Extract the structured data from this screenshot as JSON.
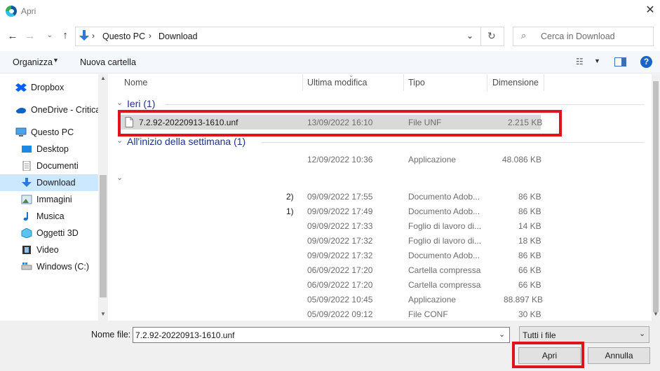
{
  "window": {
    "title": "Apri"
  },
  "address": {
    "crumbs": [
      "Questo PC",
      "Download"
    ],
    "search_placeholder": "Cerca in Download"
  },
  "toolbar": {
    "organize_label": "Organizza",
    "new_folder_label": "Nuova cartella"
  },
  "sidebar": {
    "items": [
      {
        "label": "Dropbox",
        "icon": "dropbox-icon"
      },
      {
        "label": "OneDrive - Critica",
        "icon": "onedrive-icon"
      },
      {
        "label": "Questo PC",
        "icon": "pc-icon"
      },
      {
        "label": "Desktop",
        "icon": "desktop-icon"
      },
      {
        "label": "Documenti",
        "icon": "documents-icon"
      },
      {
        "label": "Download",
        "icon": "download-icon",
        "selected": true
      },
      {
        "label": "Immagini",
        "icon": "pictures-icon"
      },
      {
        "label": "Musica",
        "icon": "music-icon"
      },
      {
        "label": "Oggetti 3D",
        "icon": "objects3d-icon"
      },
      {
        "label": "Video",
        "icon": "video-icon"
      },
      {
        "label": "Windows (C:)",
        "icon": "drive-icon"
      }
    ]
  },
  "columns": {
    "name": "Nome",
    "modified": "Ultima modifica",
    "type": "Tipo",
    "size": "Dimensione"
  },
  "groups": {
    "yesterday": "Ieri (1)",
    "week": "All'inizio della settimana (1)"
  },
  "rows": {
    "selected": {
      "name": "7.2.92-20220913-1610.unf",
      "modified": "13/09/2022 16:10",
      "type": "File UNF",
      "size": "2.215 KB"
    },
    "week": {
      "name": "",
      "modified": "12/09/2022 10:36",
      "type": "Applicazione",
      "size": "48.086 KB"
    },
    "earlier": [
      {
        "name": "2)",
        "modified": "09/09/2022 17:55",
        "type": "Documento Adob...",
        "size": "86 KB"
      },
      {
        "name": "1)",
        "modified": "09/09/2022 17:49",
        "type": "Documento Adob...",
        "size": "86 KB"
      },
      {
        "name": "",
        "modified": "09/09/2022 17:33",
        "type": "Foglio di lavoro di...",
        "size": "14 KB"
      },
      {
        "name": "",
        "modified": "09/09/2022 17:32",
        "type": "Foglio di lavoro di...",
        "size": "18 KB"
      },
      {
        "name": "",
        "modified": "09/09/2022 17:32",
        "type": "Documento Adob...",
        "size": "86 KB"
      },
      {
        "name": "",
        "modified": "06/09/2022 17:20",
        "type": "Cartella compressa",
        "size": "66 KB"
      },
      {
        "name": "",
        "modified": "06/09/2022 17:20",
        "type": "Cartella compressa",
        "size": "66 KB"
      },
      {
        "name": "",
        "modified": "05/09/2022 10:45",
        "type": "Applicazione",
        "size": "88.897 KB"
      },
      {
        "name": "",
        "modified": "05/09/2022 09:12",
        "type": "File CONF",
        "size": "30 KB"
      }
    ]
  },
  "footer": {
    "filename_label": "Nome file:",
    "filename_value": "7.2.92-20220913-1610.unf",
    "filter_value": "Tutti i file",
    "open_label": "Apri",
    "cancel_label": "Annulla"
  },
  "colors": {
    "highlight": "#e0121c",
    "selection": "#cce8ff",
    "group_text": "#1e3287"
  }
}
